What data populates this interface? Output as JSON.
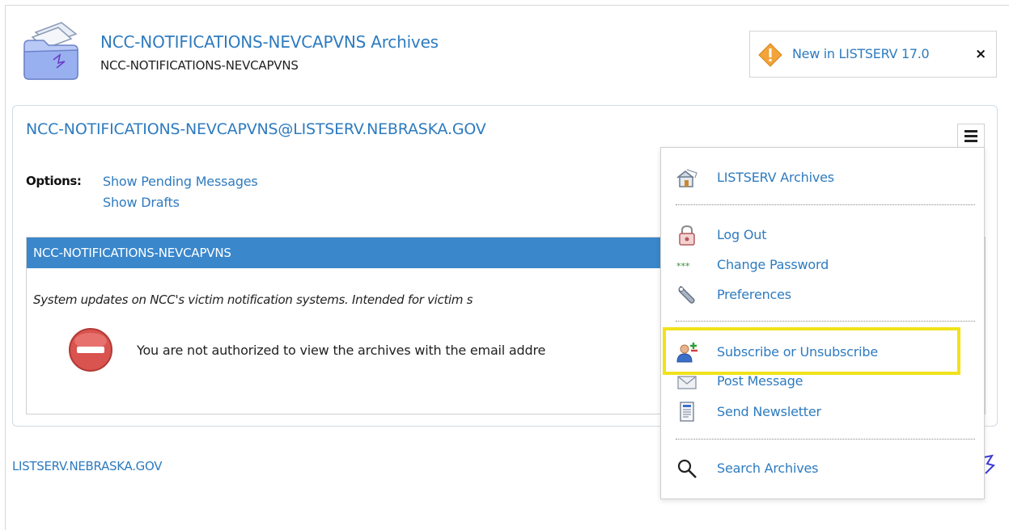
{
  "header": {
    "title": "NCC-NOTIFICATIONS-NEVCAPVNS Archives",
    "subtitle": "NCC-NOTIFICATIONS-NEVCAPVNS",
    "news_label": "New in LISTSERV 17.0",
    "news_close": "×"
  },
  "main": {
    "list_address": "NCC-NOTIFICATIONS-NEVCAPVNS@LISTSERV.NEBRASKA.GOV",
    "options_label": "Options:",
    "options": [
      "Show Pending Messages",
      "Show Drafts"
    ],
    "list_box_title": "NCC-NOTIFICATIONS-NEVCAPVNS",
    "description": "System updates on NCC's victim notification systems. Intended for victim s",
    "not_authorized": "You are not authorized to view the archives with the email addre"
  },
  "footer": {
    "host_link": "LISTSERV.NEBRASKA.GOV"
  },
  "menu": {
    "items": [
      {
        "label": "LISTSERV Archives",
        "icon": "archives-house-icon"
      },
      {
        "label": "Log Out",
        "icon": "lock-icon"
      },
      {
        "label": "Change Password",
        "icon": "password-dots-icon"
      },
      {
        "label": "Preferences",
        "icon": "wrench-icon"
      },
      {
        "label": "Subscribe or Unsubscribe",
        "icon": "subscribe-user-icon"
      },
      {
        "label": "Post Message",
        "icon": "envelope-icon"
      },
      {
        "label": "Send Newsletter",
        "icon": "newsletter-icon"
      },
      {
        "label": "Search Archives",
        "icon": "search-icon"
      }
    ]
  },
  "colors": {
    "link": "#2e7bbf",
    "header_bar": "#3a87cc",
    "highlight": "#f1e21a"
  }
}
